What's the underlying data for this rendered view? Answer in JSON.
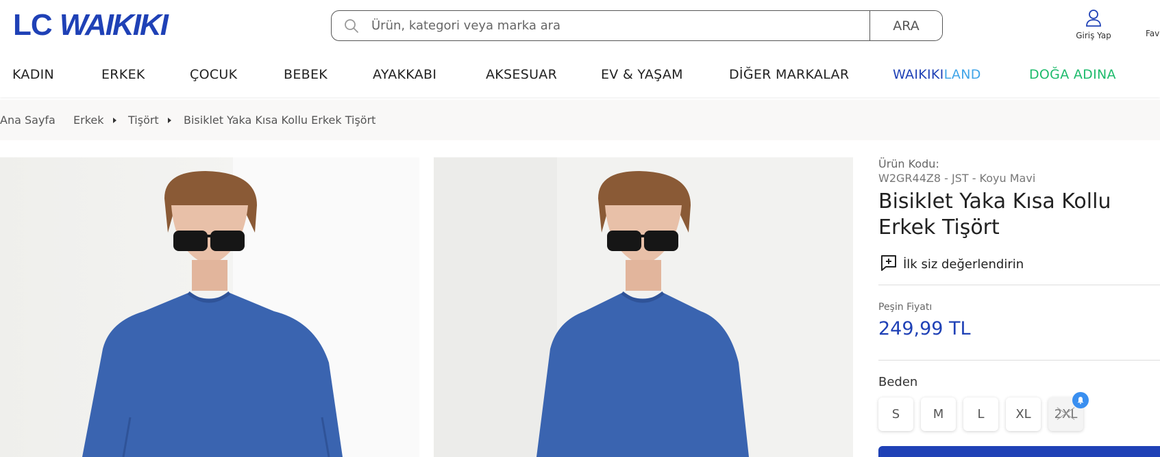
{
  "brand": {
    "logo_text_1": "LC ",
    "logo_text_2": "WAIKIKI",
    "color": "#1f41b6"
  },
  "search": {
    "placeholder": "Ürün, kategori veya marka ara",
    "button_label": "ARA",
    "icon": "search-icon"
  },
  "account": {
    "label": "Giriş Yap",
    "icon": "user-icon"
  },
  "favorites": {
    "label": "Favorilerim"
  },
  "nav": {
    "items": [
      "KADIN",
      "ERKEK",
      "ÇOCUK",
      "BEBEK",
      "AYAKKABI",
      "AKSESUAR",
      "EV & YAŞAM",
      "DİĞER MARKALAR"
    ],
    "waikiki_part1": "WAIKIKI",
    "waikiki_part2": "LAND",
    "doga": "DOĞA ADINA",
    "colors": {
      "waikiki": "#1f41b6",
      "land": "#3fa5e8",
      "doga": "#1ebb6c"
    }
  },
  "breadcrumb": [
    "Ana Sayfa",
    "Erkek",
    "Tişört",
    "Bisiklet Yaka Kısa Kollu Erkek Tişört"
  ],
  "product": {
    "code_label": "Ürün Kodu:",
    "code_value": "W2GR44Z8 - JST - Koyu Mavi",
    "title": "Bisiklet Yaka Kısa Kollu Erkek Tişört",
    "rating_text": "İlk siz değerlendirin",
    "price_label": "Peşin Fiyatı",
    "price": "249,99 TL",
    "size_label": "Beden",
    "sizes": [
      "S",
      "M",
      "L",
      "XL",
      "2XL"
    ],
    "unavailable_size": "2XL",
    "shirt_color": "#3a64b0"
  }
}
